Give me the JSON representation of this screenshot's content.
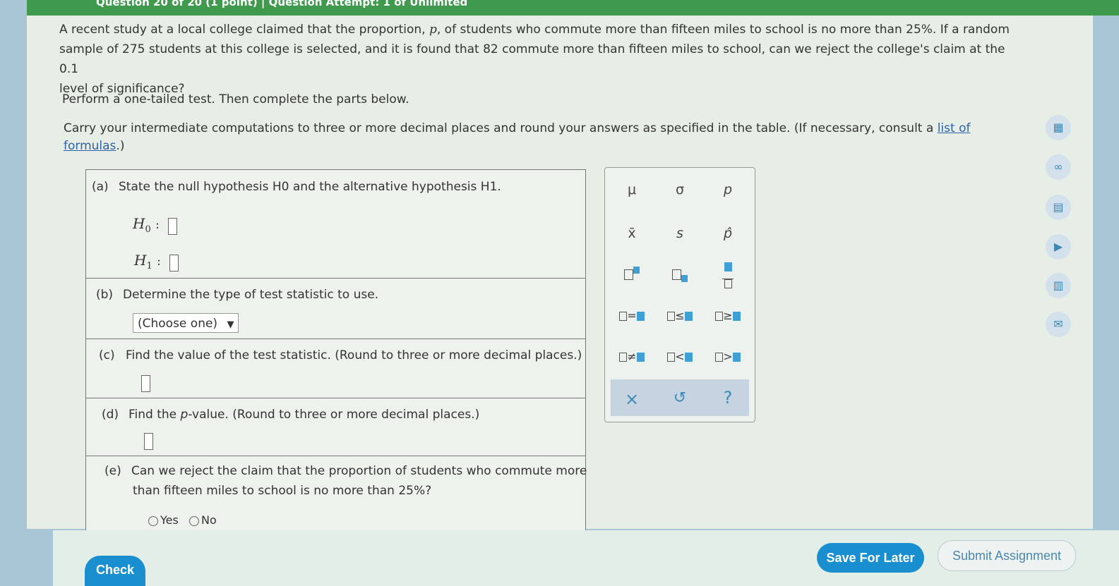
{
  "header": {
    "title": "Question 20 of 20 (1 point)  |  Question Attempt: 1 of Unlimited"
  },
  "question": {
    "line1a": "A recent study at a local college claimed that the proportion, ",
    "p_var": "p",
    "line1b": ", of students who commute more than fifteen miles to school is no more than 25%. If a random",
    "line2": "sample of 275 students at this college is selected, and it is found that 82 commute more than fifteen miles to school, can we reject the college's claim at the 0.1",
    "line3": "level of significance?",
    "instruction": "Perform a one-tailed test. Then complete the parts below.",
    "carry_text": "Carry your intermediate computations to three or more decimal places and round your answers as specified in the table. (If necessary, consult a ",
    "link_part1": "list of",
    "link_part2": "formulas",
    "carry_end": ".)"
  },
  "parts": {
    "a": {
      "tag": "(a)",
      "text": "State the null hypothesis H0 and the alternative hypothesis H1.",
      "h0": "H",
      "h0_sub": "0",
      "h1": "H",
      "h1_sub": "1",
      "colon": ":"
    },
    "b": {
      "tag": "(b)",
      "text": "Determine the type of test statistic to use.",
      "select_value": "(Choose one)",
      "arrow": "▼"
    },
    "c": {
      "tag": "(c)",
      "text": "Find the value of the test statistic. (Round to three or more decimal places.)"
    },
    "d": {
      "tag": "(d)",
      "text_a": "Find the ",
      "p": "p",
      "text_b": "-value. (Round to three or more decimal places.)"
    },
    "e": {
      "tag": "(e)",
      "text1": "Can we reject the claim that the proportion of students who commute more",
      "text2": "than fifteen miles to school is no more than 25%?",
      "yes": "Yes",
      "no": "No"
    }
  },
  "palette": {
    "mu": "μ",
    "sigma": "σ",
    "p": "p",
    "xbar": "x̄",
    "s": "s",
    "phat": "p̂",
    "eq": "=",
    "le": "≤",
    "ge": "≥",
    "ne": "≠",
    "lt": "<",
    "gt": ">",
    "clear": "×",
    "undo": "↺",
    "help": "?"
  },
  "footer": {
    "check": "Check",
    "save": "Save For Later",
    "submit": "Submit Assignment"
  },
  "colors": {
    "header_green": "#3f9a4e",
    "button_blue": "#1a8fd0",
    "link_blue": "#2d62a8"
  }
}
